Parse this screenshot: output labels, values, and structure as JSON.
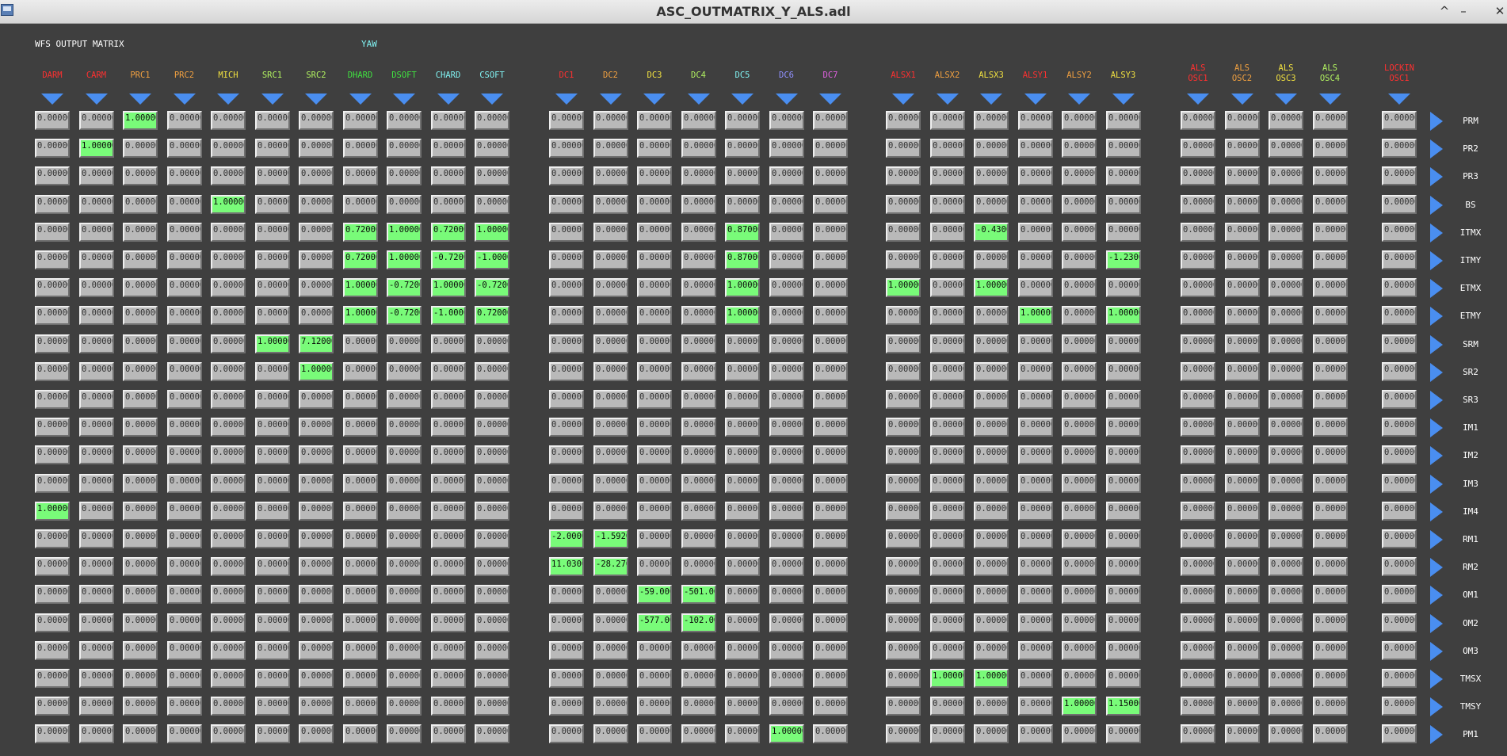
{
  "window": {
    "title": "ASC_OUTMATRIX_Y_ALS.adl",
    "controls": [
      "^",
      "–",
      "✕"
    ]
  },
  "labels": {
    "matrix_title": "WFS OUTPUT MATRIX",
    "dof": "YAW"
  },
  "default_value": "0.00000",
  "columns": [
    {
      "label": "DARM",
      "color": "#ff3030"
    },
    {
      "label": "CARM",
      "color": "#ff3030"
    },
    {
      "label": "PRC1",
      "color": "#f0a040"
    },
    {
      "label": "PRC2",
      "color": "#f0a040"
    },
    {
      "label": "MICH",
      "color": "#f0e040"
    },
    {
      "label": "SRC1",
      "color": "#b0f060"
    },
    {
      "label": "SRC2",
      "color": "#b0f060"
    },
    {
      "label": "DHARD",
      "color": "#40e040"
    },
    {
      "label": "DSOFT",
      "color": "#40e040"
    },
    {
      "label": "CHARD",
      "color": "#80f0f0"
    },
    {
      "label": "CSOFT",
      "color": "#80f0f0"
    },
    {
      "label": "DC1",
      "color": "#ff3030"
    },
    {
      "label": "DC2",
      "color": "#f0a040"
    },
    {
      "label": "DC3",
      "color": "#f0e040"
    },
    {
      "label": "DC4",
      "color": "#b0f060"
    },
    {
      "label": "DC5",
      "color": "#80f0f0"
    },
    {
      "label": "DC6",
      "color": "#9090ff"
    },
    {
      "label": "DC7",
      "color": "#e060e0"
    },
    {
      "label": "ALSX1",
      "color": "#ff3030"
    },
    {
      "label": "ALSX2",
      "color": "#f0a040"
    },
    {
      "label": "ALSX3",
      "color": "#f0e040"
    },
    {
      "label": "ALSY1",
      "color": "#ff3030"
    },
    {
      "label": "ALSY2",
      "color": "#f0a040"
    },
    {
      "label": "ALSY3",
      "color": "#f0e040"
    },
    {
      "label": "ALS OSC1",
      "color": "#ff3030"
    },
    {
      "label": "ALS OSC2",
      "color": "#f0a040"
    },
    {
      "label": "ALS OSC3",
      "color": "#f0e040"
    },
    {
      "label": "ALS OSC4",
      "color": "#b0f060"
    },
    {
      "label": "LOCKIN OSC1",
      "color": "#ff3030"
    }
  ],
  "rows": [
    "PRM",
    "PR2",
    "PR3",
    "BS",
    "ITMX",
    "ITMY",
    "ETMX",
    "ETMY",
    "SRM",
    "SR2",
    "SR3",
    "IM1",
    "IM2",
    "IM3",
    "IM4",
    "RM1",
    "RM2",
    "OM1",
    "OM2",
    "OM3",
    "TMSX",
    "TMSY",
    "PM1"
  ],
  "nonzero": [
    {
      "r": 0,
      "c": 2,
      "v": "1.00000"
    },
    {
      "r": 1,
      "c": 1,
      "v": "1.00000"
    },
    {
      "r": 3,
      "c": 4,
      "v": "1.00000"
    },
    {
      "r": 4,
      "c": 7,
      "v": "0.72000"
    },
    {
      "r": 4,
      "c": 8,
      "v": "1.00000"
    },
    {
      "r": 4,
      "c": 9,
      "v": "0.72000"
    },
    {
      "r": 4,
      "c": 10,
      "v": "1.00000"
    },
    {
      "r": 4,
      "c": 15,
      "v": "0.87000"
    },
    {
      "r": 4,
      "c": 20,
      "v": "-0.43000"
    },
    {
      "r": 5,
      "c": 7,
      "v": "0.72000"
    },
    {
      "r": 5,
      "c": 8,
      "v": "1.00000"
    },
    {
      "r": 5,
      "c": 9,
      "v": "-0.72000"
    },
    {
      "r": 5,
      "c": 10,
      "v": "-1.00000"
    },
    {
      "r": 5,
      "c": 15,
      "v": "0.87000"
    },
    {
      "r": 5,
      "c": 23,
      "v": "-1.23000"
    },
    {
      "r": 6,
      "c": 7,
      "v": "1.00000"
    },
    {
      "r": 6,
      "c": 8,
      "v": "-0.72000"
    },
    {
      "r": 6,
      "c": 9,
      "v": "1.00000"
    },
    {
      "r": 6,
      "c": 10,
      "v": "-0.72000"
    },
    {
      "r": 6,
      "c": 15,
      "v": "1.00000"
    },
    {
      "r": 6,
      "c": 18,
      "v": "1.00000"
    },
    {
      "r": 6,
      "c": 20,
      "v": "1.00000"
    },
    {
      "r": 7,
      "c": 7,
      "v": "1.00000"
    },
    {
      "r": 7,
      "c": 8,
      "v": "-0.72000"
    },
    {
      "r": 7,
      "c": 9,
      "v": "-1.00000"
    },
    {
      "r": 7,
      "c": 10,
      "v": "0.72000"
    },
    {
      "r": 7,
      "c": 15,
      "v": "1.00000"
    },
    {
      "r": 7,
      "c": 21,
      "v": "1.00000"
    },
    {
      "r": 7,
      "c": 23,
      "v": "1.00000"
    },
    {
      "r": 8,
      "c": 5,
      "v": "1.00000"
    },
    {
      "r": 8,
      "c": 6,
      "v": "7.12000"
    },
    {
      "r": 9,
      "c": 6,
      "v": "1.00000"
    },
    {
      "r": 14,
      "c": 0,
      "v": "1.00000"
    },
    {
      "r": 15,
      "c": 11,
      "v": "-2.00000"
    },
    {
      "r": 15,
      "c": 12,
      "v": "-1.59200"
    },
    {
      "r": 16,
      "c": 11,
      "v": "11.03000"
    },
    {
      "r": 16,
      "c": 12,
      "v": "-28.27000"
    },
    {
      "r": 17,
      "c": 13,
      "v": "-59.00000"
    },
    {
      "r": 17,
      "c": 14,
      "v": "-501.00000"
    },
    {
      "r": 18,
      "c": 13,
      "v": "-577.00000"
    },
    {
      "r": 18,
      "c": 14,
      "v": "-102.00000"
    },
    {
      "r": 20,
      "c": 19,
      "v": "1.00000"
    },
    {
      "r": 20,
      "c": 20,
      "v": "1.00000"
    },
    {
      "r": 21,
      "c": 22,
      "v": "1.00000"
    },
    {
      "r": 21,
      "c": 23,
      "v": "1.15000"
    },
    {
      "r": 22,
      "c": 16,
      "v": "1.00000"
    }
  ]
}
